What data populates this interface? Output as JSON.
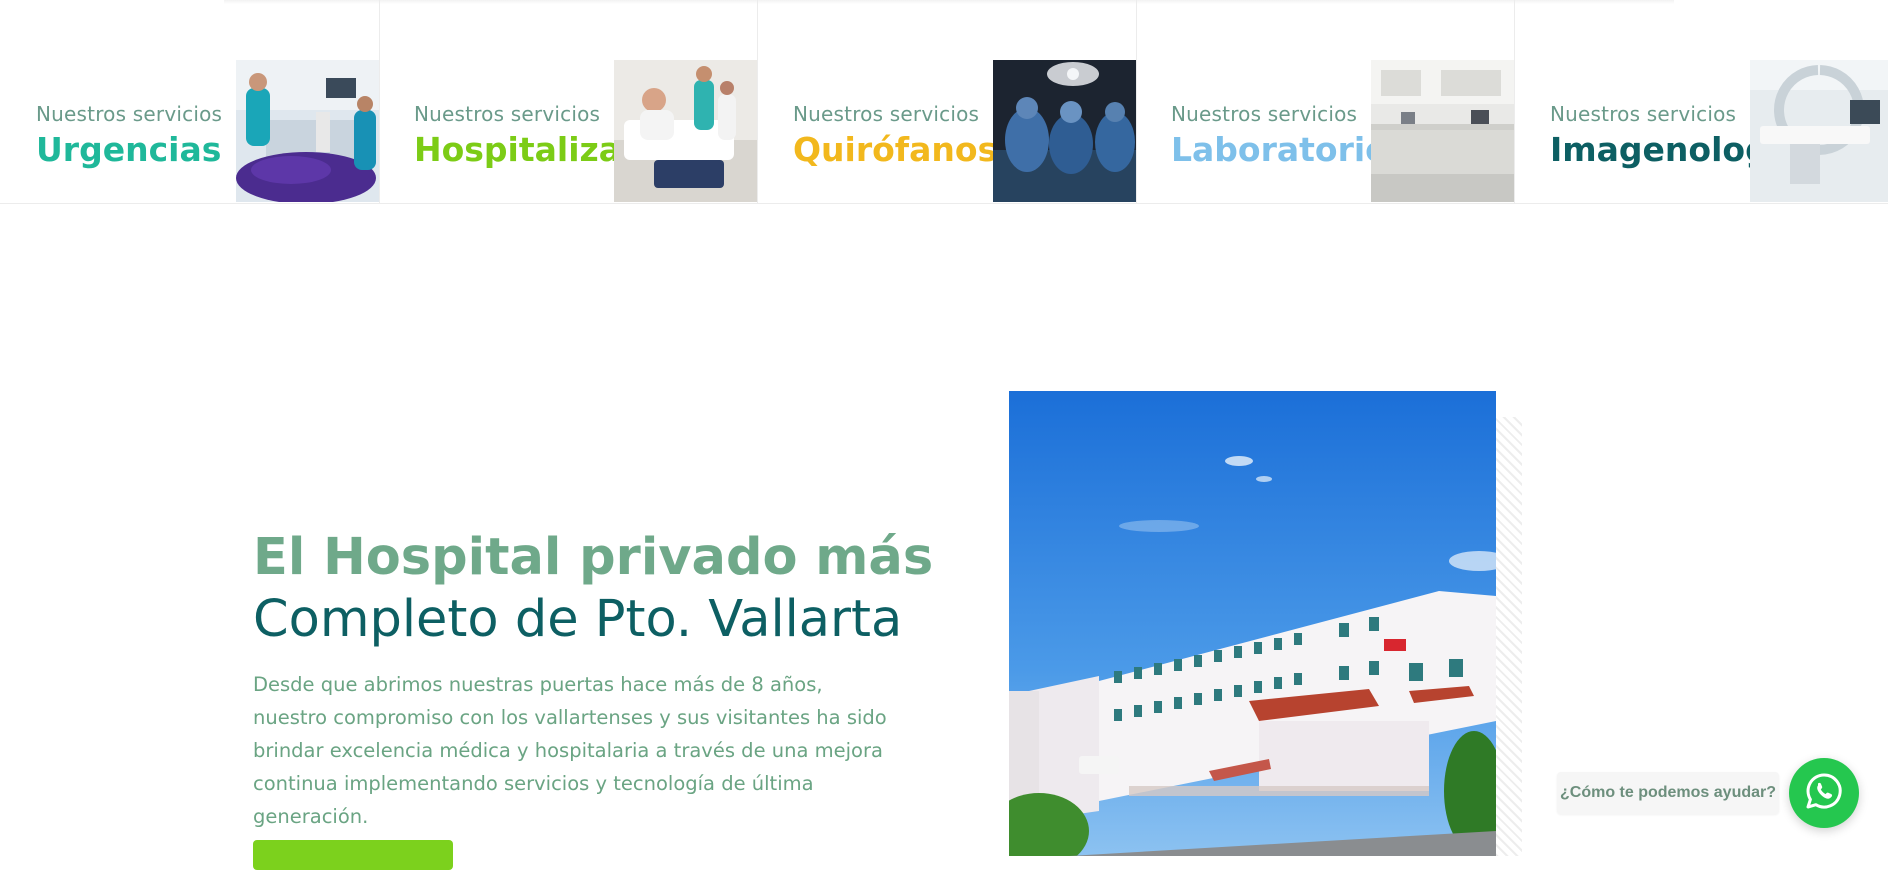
{
  "services": {
    "kicker": "Nuestros servicios",
    "items": [
      {
        "name": "Urgencias",
        "color": "#1fb89a",
        "icon": "emergency-room-photo"
      },
      {
        "name": "Hospitalización",
        "color": "#7ccc16",
        "icon": "hospital-room-photo"
      },
      {
        "name": "Quirófanos",
        "color": "#f2b81d",
        "icon": "operating-room-photo"
      },
      {
        "name": "Laboratorio",
        "color": "#7ec0ea",
        "icon": "laboratory-photo"
      },
      {
        "name": "Imagenología",
        "color": "#0d5f63",
        "icon": "imaging-room-photo"
      }
    ]
  },
  "hero": {
    "title_bold": "El Hospital privado más",
    "title_light": "Completo de Pto. Vallarta",
    "description": "Desde que abrimos nuestras puertas hace más de 8 años, nuestro compromiso con los vallartenses y sus visitantes ha sido brindar excelencia médica y hospitalaria a través de una mejora continua implementando servicios y tecnología de última generación.",
    "image_icon": "hospital-building-photo"
  },
  "whatsapp": {
    "label": "¿Cómo te podemos ayudar?",
    "icon": "whatsapp-icon",
    "color": "#25c74f"
  }
}
